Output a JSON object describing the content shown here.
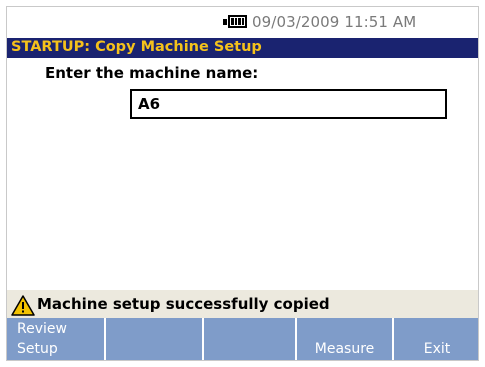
{
  "status_bar": {
    "battery_icon": "battery-full-icon",
    "datetime": "09/03/2009 11:51 AM"
  },
  "title_bar": {
    "title": "STARTUP: Copy Machine Setup"
  },
  "form": {
    "prompt": "Enter the machine name:",
    "machine_name_value": "A6"
  },
  "message": {
    "icon": "warning-icon",
    "text": "Machine setup successfully copied"
  },
  "softkeys": {
    "key1_line1": "Review",
    "key1_line2": "Setup",
    "key2": "",
    "key3": "",
    "key4": "Measure",
    "key5": "Exit"
  },
  "colors": {
    "title_background": "#1a2370",
    "title_text": "#f5c21b",
    "softkey_background": "#7f9cc9",
    "message_background": "#ece9de",
    "datetime_text": "#7a7a7a"
  }
}
